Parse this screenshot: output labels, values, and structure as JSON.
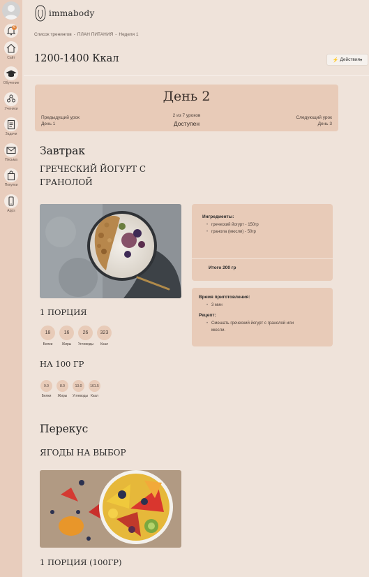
{
  "sidebar": {
    "items": [
      {
        "icon": "bell-icon",
        "label": "",
        "badge": "6"
      },
      {
        "icon": "home-icon",
        "label": "Сайт"
      },
      {
        "icon": "graduation-cap-icon",
        "label": "Обучение"
      },
      {
        "icon": "students-icon",
        "label": "Ученики"
      },
      {
        "icon": "clipboard-icon",
        "label": "Задачи"
      },
      {
        "icon": "envelope-icon",
        "label": "Письма"
      },
      {
        "icon": "shopping-bag-icon",
        "label": "Покупки"
      },
      {
        "icon": "phone-icon",
        "label": "Apps"
      }
    ]
  },
  "header": {
    "logo_text": "immabody",
    "breadcrumb": [
      "Список тренингов",
      "ПЛАН ПИТАНИЯ",
      "Неделя 1"
    ],
    "breadcrumb_sep": "-",
    "title": "1200-1400 Ккал",
    "actions_label": "Действия",
    "actions_caret": "▾"
  },
  "day": {
    "title": "День 2",
    "prev_label": "Предыдущий урок",
    "prev_day": "День 1",
    "progress": "2 из 7 уроков",
    "status": "Доступен",
    "next_label": "Следующий урок",
    "next_day": "День 3"
  },
  "breakfast": {
    "heading": "Завтрак",
    "dish_line1": "ГРЕЧЕСКИЙ ЙОГУРТ С",
    "dish_line2": "ГРАНОЛОЙ",
    "portion_title": "1 ПОРЦИЯ",
    "portion_macros": [
      {
        "value": "18",
        "label": "Белки"
      },
      {
        "value": "16",
        "label": "Жиры"
      },
      {
        "value": "26",
        "label": "Углеводы"
      },
      {
        "value": "323",
        "label": "Ккал"
      }
    ],
    "per100_title": "НА 100 ГР",
    "per100_macros": [
      {
        "value": "9.0",
        "label": "Белки"
      },
      {
        "value": "8.0",
        "label": "Жиры"
      },
      {
        "value": "13.0",
        "label": "Углеводы"
      },
      {
        "value": "161.5",
        "label": "Ккал"
      }
    ],
    "ingredients_title": "Ингредиенты:",
    "ingredients": [
      "греческий йогурт - 150гр",
      "гранола (мюсли) - 50гр"
    ],
    "total": "Итого 200 гр",
    "prep_title": "Время приготовления:",
    "prep_items": [
      "3 мин"
    ],
    "recipe_title": "Рецепт:",
    "recipe_items": [
      "Смешать греческий йогурт с гранолой или",
      "мюсли."
    ]
  },
  "snack": {
    "heading": "Перекус",
    "dish": "ЯГОДЫ НА ВЫБОР",
    "portion_title": "1 ПОРЦИЯ (100ГР)"
  },
  "colors": {
    "background": "#efe3da",
    "sidebar": "#e8cdbd",
    "panel": "#e8cbb8",
    "badge": "#e0833c"
  }
}
